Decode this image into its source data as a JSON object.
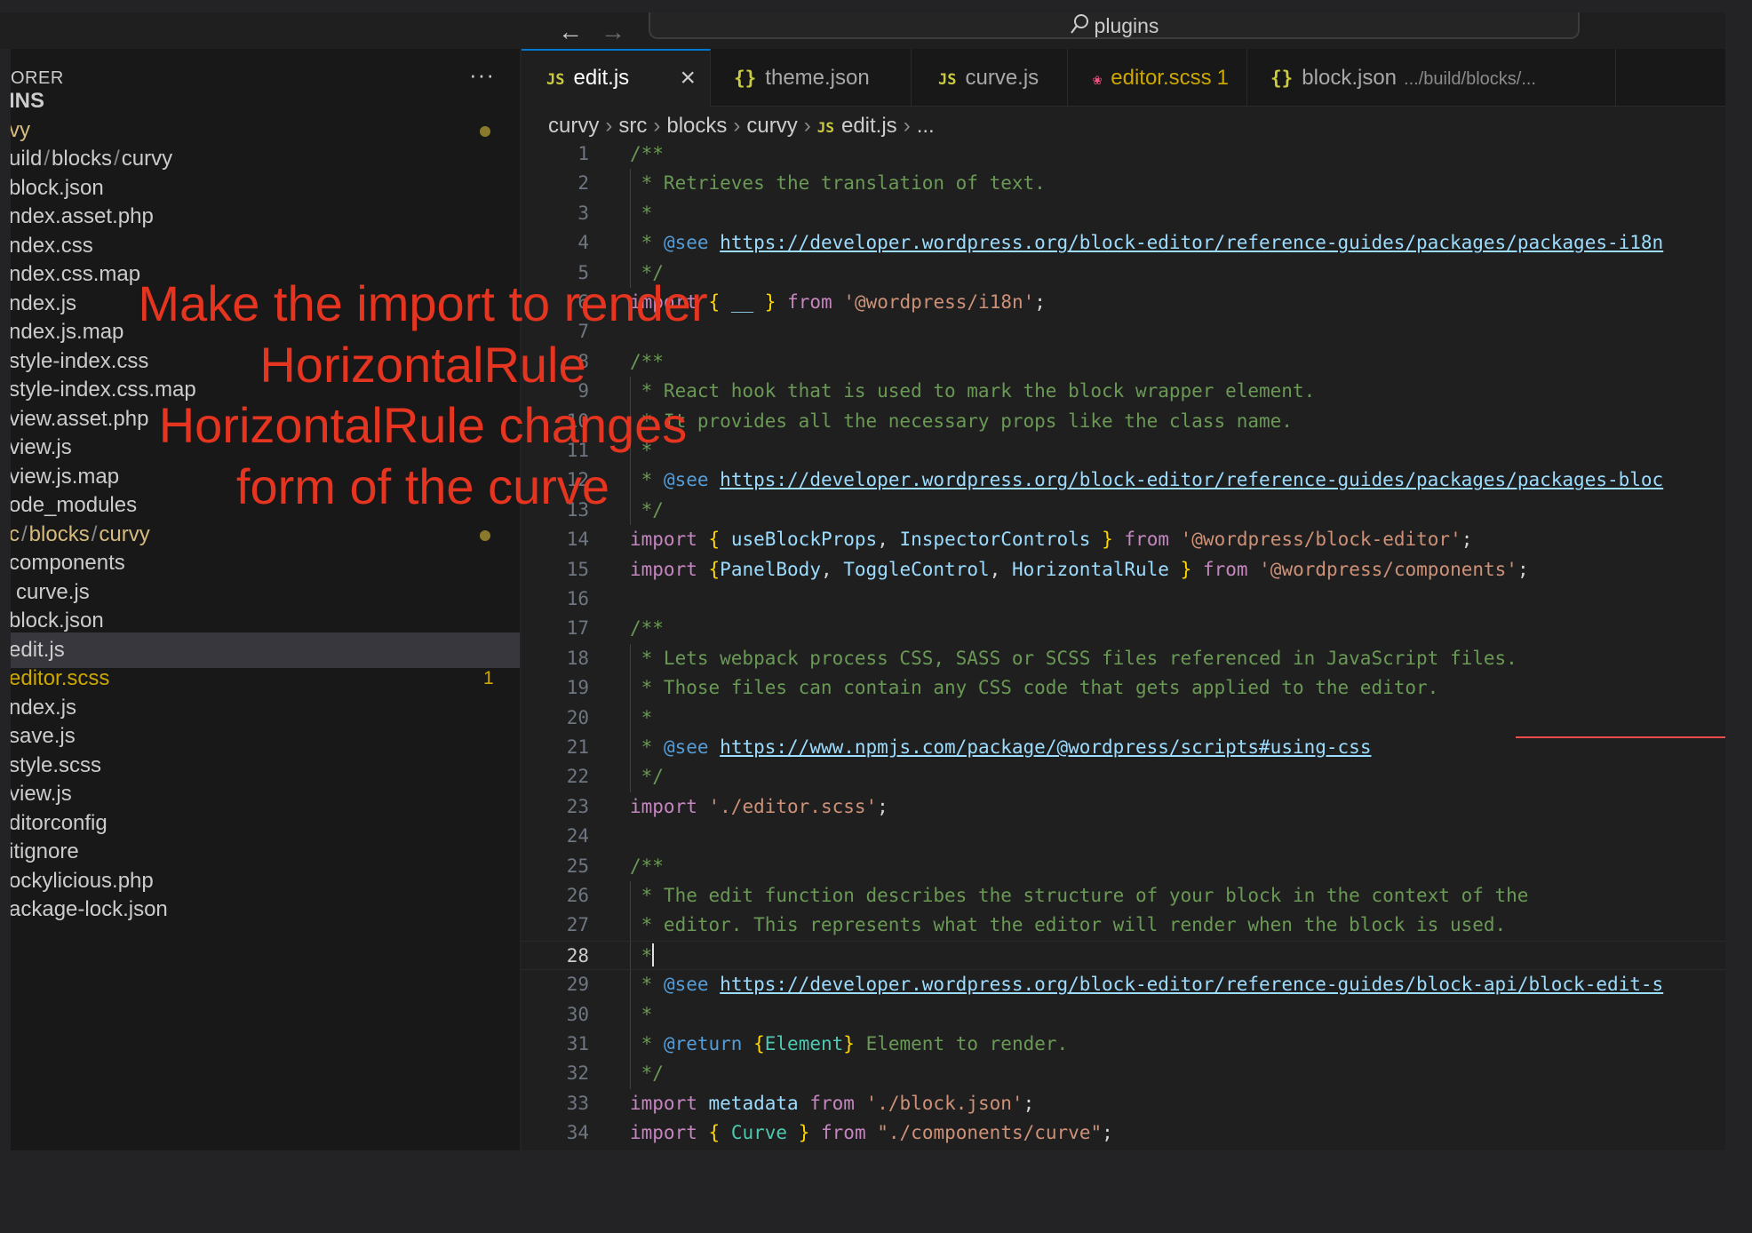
{
  "titlebar": {
    "back_icon": "←",
    "forward_icon": "→",
    "search_text": "plugins"
  },
  "sidebar": {
    "title": "ORER",
    "more_icon": "···",
    "items": [
      {
        "text": "INS",
        "bold": true
      },
      {
        "text": "vy",
        "modified": true
      },
      {
        "parts": [
          "uild",
          "blocks",
          "curvy"
        ]
      },
      {
        "text": "block.json"
      },
      {
        "text": "ndex.asset.php"
      },
      {
        "text": "ndex.css"
      },
      {
        "text": "ndex.css.map"
      },
      {
        "text": "ndex.js"
      },
      {
        "text": "ndex.js.map"
      },
      {
        "text": "style-index.css"
      },
      {
        "text": "style-index.css.map"
      },
      {
        "text": "view.asset.php"
      },
      {
        "text": "view.js"
      },
      {
        "text": "view.js.map"
      },
      {
        "text": "ode_modules"
      },
      {
        "parts": [
          "c",
          "blocks",
          "curvy"
        ],
        "modified": true
      },
      {
        "text": "components"
      },
      {
        "text": "curve.js",
        "indent": true
      },
      {
        "text": "block.json"
      },
      {
        "text": "edit.js",
        "selected": true
      },
      {
        "text": "editor.scss",
        "warning": true,
        "count": "1"
      },
      {
        "text": "ndex.js"
      },
      {
        "text": "save.js"
      },
      {
        "text": "style.scss"
      },
      {
        "text": "view.js"
      },
      {
        "text": "ditorconfig"
      },
      {
        "text": "itignore"
      },
      {
        "text": "ockylicious.php"
      },
      {
        "text": "ackage-lock.json"
      }
    ]
  },
  "tabs": [
    {
      "icon": "JS",
      "label": "edit.js",
      "active": true,
      "close": "×"
    },
    {
      "icon": "{}",
      "label": "theme.json"
    },
    {
      "icon": "JS",
      "label": "curve.js"
    },
    {
      "icon": "sass",
      "label": "editor.scss",
      "problems": "1"
    },
    {
      "icon": "{}",
      "label": "block.json",
      "desc": ".../build/blocks/..."
    }
  ],
  "breadcrumb": [
    "curvy",
    "src",
    "blocks",
    "curvy",
    "edit.js",
    "..."
  ],
  "editor": {
    "current_line": 28,
    "lines": [
      [
        [
          "cm",
          "/**"
        ]
      ],
      [
        [
          "cm",
          " * Retrieves the translation of text."
        ]
      ],
      [
        [
          "cm",
          " *"
        ]
      ],
      [
        [
          "cm",
          " * "
        ],
        [
          "tagk",
          "@see"
        ],
        [
          "cm",
          " "
        ],
        [
          "link",
          "https://developer.wordpress.org/block-editor/reference-guides/packages/packages-i18n"
        ]
      ],
      [
        [
          "cm",
          " */"
        ]
      ],
      [
        [
          "kw",
          "import"
        ],
        [
          "pl",
          " "
        ],
        [
          "br",
          "{"
        ],
        [
          "pl",
          " "
        ],
        [
          "id",
          "__"
        ],
        [
          "pl",
          " "
        ],
        [
          "br",
          "}"
        ],
        [
          "pl",
          " "
        ],
        [
          "kw",
          "from"
        ],
        [
          "pl",
          " "
        ],
        [
          "str",
          "'@wordpress/i18n'"
        ],
        [
          "pl",
          ";"
        ]
      ],
      [],
      [
        [
          "cm",
          "/**"
        ]
      ],
      [
        [
          "cm",
          " * React hook that is used to mark the block wrapper element."
        ]
      ],
      [
        [
          "cm",
          " * It provides all the necessary props like the class name."
        ]
      ],
      [
        [
          "cm",
          " *"
        ]
      ],
      [
        [
          "cm",
          " * "
        ],
        [
          "tagk",
          "@see"
        ],
        [
          "cm",
          " "
        ],
        [
          "link",
          "https://developer.wordpress.org/block-editor/reference-guides/packages/packages-bloc"
        ]
      ],
      [
        [
          "cm",
          " */"
        ]
      ],
      [
        [
          "kw",
          "import"
        ],
        [
          "pl",
          " "
        ],
        [
          "br",
          "{"
        ],
        [
          "pl",
          " "
        ],
        [
          "id",
          "useBlockProps"
        ],
        [
          "pl",
          ", "
        ],
        [
          "id",
          "InspectorControls"
        ],
        [
          "pl",
          " "
        ],
        [
          "br",
          "}"
        ],
        [
          "pl",
          " "
        ],
        [
          "kw",
          "from"
        ],
        [
          "pl",
          " "
        ],
        [
          "str",
          "'@wordpress/block-editor'"
        ],
        [
          "pl",
          ";"
        ]
      ],
      [
        [
          "kw",
          "import"
        ],
        [
          "pl",
          " "
        ],
        [
          "br",
          "{"
        ],
        [
          "id",
          "PanelBody"
        ],
        [
          "pl",
          ", "
        ],
        [
          "id",
          "ToggleControl"
        ],
        [
          "pl",
          ", "
        ],
        [
          "id",
          "HorizontalRule"
        ],
        [
          "pl",
          " "
        ],
        [
          "br",
          "}"
        ],
        [
          "pl",
          " "
        ],
        [
          "kw",
          "from"
        ],
        [
          "pl",
          " "
        ],
        [
          "str",
          "'@wordpress/components'"
        ],
        [
          "pl",
          ";"
        ]
      ],
      [],
      [
        [
          "cm",
          "/**"
        ]
      ],
      [
        [
          "cm",
          " * Lets webpack process CSS, SASS or SCSS files referenced in JavaScript files."
        ]
      ],
      [
        [
          "cm",
          " * Those files can contain any CSS code that gets applied to the editor."
        ]
      ],
      [
        [
          "cm",
          " *"
        ]
      ],
      [
        [
          "cm",
          " * "
        ],
        [
          "tagk",
          "@see"
        ],
        [
          "cm",
          " "
        ],
        [
          "link",
          "https://www.npmjs.com/package/@wordpress/scripts#using-css"
        ]
      ],
      [
        [
          "cm",
          " */"
        ]
      ],
      [
        [
          "kw",
          "import"
        ],
        [
          "pl",
          " "
        ],
        [
          "str",
          "'./editor.scss'"
        ],
        [
          "pl",
          ";"
        ]
      ],
      [],
      [
        [
          "cm",
          "/**"
        ]
      ],
      [
        [
          "cm",
          " * The edit function describes the structure of your block in the context of the"
        ]
      ],
      [
        [
          "cm",
          " * editor. This represents what the editor will render when the block is used."
        ]
      ],
      [
        [
          "cm",
          " *"
        ],
        [
          "caret",
          ""
        ]
      ],
      [
        [
          "cm",
          " * "
        ],
        [
          "tagk",
          "@see"
        ],
        [
          "cm",
          " "
        ],
        [
          "link",
          "https://developer.wordpress.org/block-editor/reference-guides/block-api/block-edit-s"
        ]
      ],
      [
        [
          "cm",
          " *"
        ]
      ],
      [
        [
          "cm",
          " * "
        ],
        [
          "tagk",
          "@return"
        ],
        [
          "cm",
          " "
        ],
        [
          "br",
          "{"
        ],
        [
          "ty",
          "Element"
        ],
        [
          "br",
          "}"
        ],
        [
          "cm",
          " Element to render."
        ]
      ],
      [
        [
          "cm",
          " */"
        ]
      ],
      [
        [
          "kw",
          "import"
        ],
        [
          "pl",
          " "
        ],
        [
          "id",
          "metadata"
        ],
        [
          "pl",
          " "
        ],
        [
          "kw",
          "from"
        ],
        [
          "pl",
          " "
        ],
        [
          "str",
          "'./block.json'"
        ],
        [
          "pl",
          ";"
        ]
      ],
      [
        [
          "kw",
          "import"
        ],
        [
          "pl",
          " "
        ],
        [
          "br",
          "{"
        ],
        [
          "pl",
          " "
        ],
        [
          "ty",
          "Curve"
        ],
        [
          "pl",
          " "
        ],
        [
          "br",
          "}"
        ],
        [
          "pl",
          " "
        ],
        [
          "kw",
          "from"
        ],
        [
          "pl",
          " "
        ],
        [
          "str",
          "\"./components/curve\""
        ],
        [
          "pl",
          ";"
        ]
      ]
    ]
  },
  "annotation": {
    "lines": [
      "Make the import to render",
      "HorizontalRule",
      "HorizontalRule changes",
      "form of the curve"
    ],
    "color": "#e5341f"
  },
  "colors": {
    "background": "#1f1f1f",
    "sidebar": "#181818",
    "accent": "#0078d4",
    "warning": "#cca700",
    "error_squiggle": "#f14c4c"
  }
}
